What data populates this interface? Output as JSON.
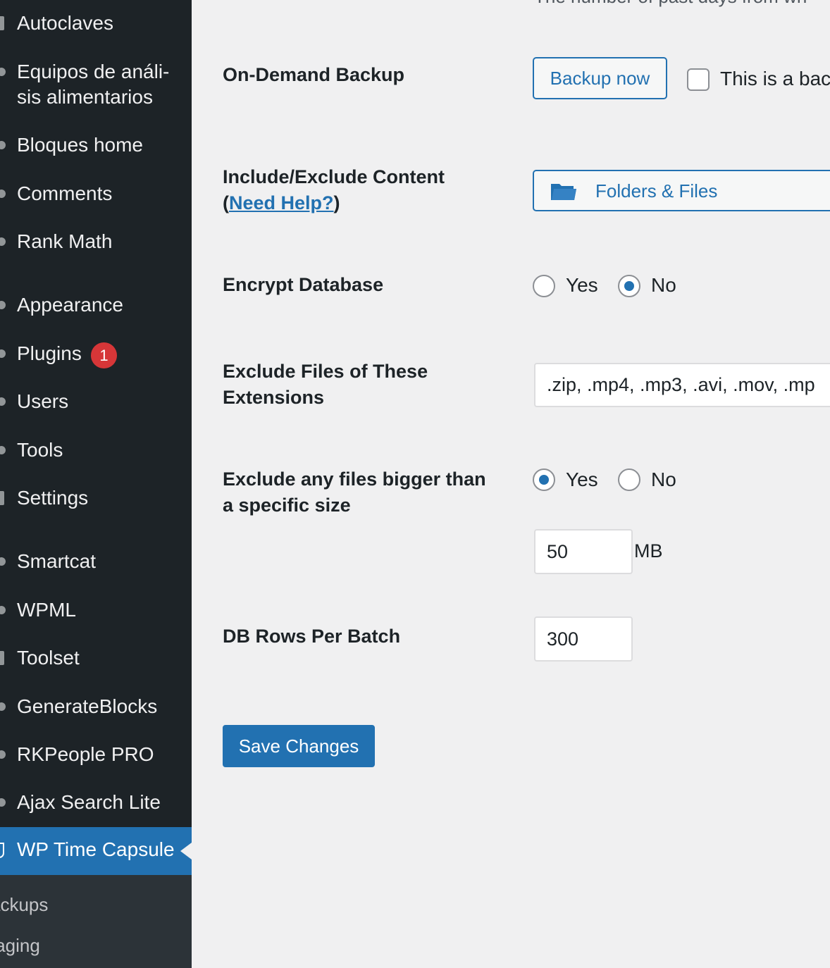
{
  "sidebar": {
    "items": [
      {
        "label": "Autoclaves",
        "icon": "autoclaves-icon"
      },
      {
        "label": "Equipos de análi-",
        "label2": "sis alimentarios",
        "icon": "equipos-icon"
      },
      {
        "label": "Bloques home",
        "icon": "bloques-icon"
      },
      {
        "label": "Comments",
        "icon": "comments-icon"
      },
      {
        "label": "Rank Math",
        "icon": "rank-math-icon"
      },
      {
        "label": "Appearance",
        "icon": "appearance-icon"
      },
      {
        "label": "Plugins",
        "icon": "plugins-icon",
        "badge": "1"
      },
      {
        "label": "Users",
        "icon": "users-icon"
      },
      {
        "label": "Tools",
        "icon": "tools-icon"
      },
      {
        "label": "Settings",
        "icon": "settings-icon"
      },
      {
        "label": "Smartcat",
        "icon": "smartcat-icon"
      },
      {
        "label": "WPML",
        "icon": "wpml-icon"
      },
      {
        "label": "Toolset",
        "icon": "toolset-icon"
      },
      {
        "label": "GenerateBlocks",
        "icon": "generateblocks-icon"
      },
      {
        "label": "RKPeople PRO",
        "icon": "rkpeople-icon"
      },
      {
        "label": "Ajax Search Lite",
        "icon": "ajax-search-icon"
      }
    ],
    "active_item": {
      "label": "WP Time Capsule",
      "icon": "shield-icon"
    },
    "submenu": [
      "ackups",
      "taging"
    ],
    "accent_color": "#2271b1",
    "badge_color": "#d63638"
  },
  "main": {
    "cut_text": "The number of past days from wh",
    "on_demand": {
      "label": "On-Demand Backup",
      "button": "Backup now",
      "checkbox_label": "This is a bac"
    },
    "include_exclude": {
      "label_line1": "Include/Exclude Content",
      "label_open": "(",
      "help_link": "Need Help?",
      "label_close": ")",
      "button": "Folders & Files",
      "icon": "folder-icon"
    },
    "encrypt": {
      "label": "Encrypt Database",
      "options": [
        "Yes",
        "No"
      ],
      "selected": "No"
    },
    "exclude_ext": {
      "label_line1": "Exclude Files of These",
      "label_line2": "Extensions",
      "value": ".zip, .mp4, .mp3, .avi, .mov, .mp"
    },
    "exclude_size": {
      "label_line1": "Exclude any files bigger than",
      "label_line2": "a specific size",
      "options": [
        "Yes",
        "No"
      ],
      "selected": "Yes",
      "size_value": "50",
      "unit": "MB"
    },
    "db_rows": {
      "label": "DB Rows Per Batch",
      "value": "300"
    },
    "save_button": "Save Changes"
  }
}
